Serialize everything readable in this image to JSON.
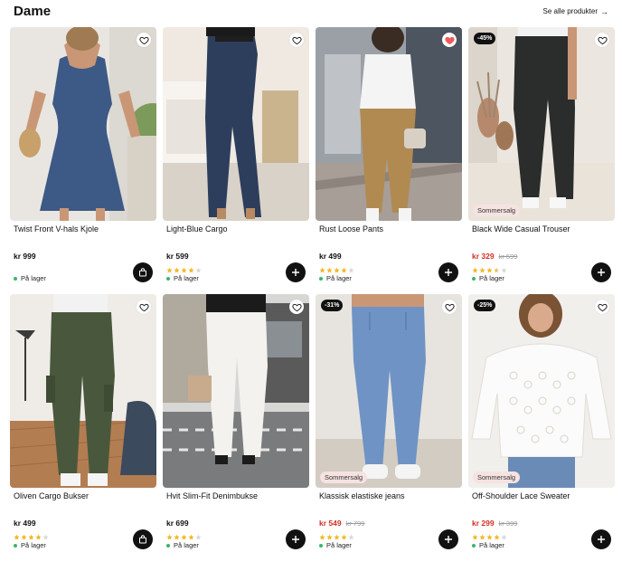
{
  "header": {
    "title": "Dame",
    "see_all": "Se alle produkter",
    "see_all_icon": "arrow-right-icon"
  },
  "colors": {
    "sale_price": "#d02e26",
    "in_stock_dot": "#3bb46b",
    "star_filled": "#f2b822",
    "star_empty": "#d9d9d9",
    "button_bg": "#111111",
    "heart_active": "#f15a5a"
  },
  "products": [
    {
      "name": "Twist Front V-hals Kjole",
      "price": "kr 999",
      "old_price": "",
      "badge": "",
      "sale_tag": "",
      "rating": 0,
      "stock": "På lager",
      "favorited": false,
      "button_icon": "shopping-bag-icon"
    },
    {
      "name": "Light-Blue Cargo",
      "price": "kr 599",
      "old_price": "",
      "badge": "",
      "sale_tag": "",
      "rating": 4,
      "stock": "På lager",
      "favorited": false,
      "button_icon": "plus-icon"
    },
    {
      "name": "Rust Loose Pants",
      "price": "kr 499",
      "old_price": "",
      "badge": "",
      "sale_tag": "",
      "rating": 4,
      "stock": "På lager",
      "favorited": true,
      "button_icon": "plus-icon"
    },
    {
      "name": "Black Wide Casual Trouser",
      "price": "kr 329",
      "old_price": "kr 599",
      "badge": "-45%",
      "sale_tag": "Sommersalg",
      "rating": 3.5,
      "stock": "På lager",
      "favorited": false,
      "button_icon": "plus-icon"
    },
    {
      "name": "Oliven Cargo Bukser",
      "price": "kr 499",
      "old_price": "",
      "badge": "",
      "sale_tag": "",
      "rating": 4,
      "stock": "På lager",
      "favorited": false,
      "button_icon": "shopping-bag-icon"
    },
    {
      "name": "Hvit Slim-Fit Denimbukse",
      "price": "kr 699",
      "old_price": "",
      "badge": "",
      "sale_tag": "",
      "rating": 4,
      "stock": "På lager",
      "favorited": false,
      "button_icon": "plus-icon"
    },
    {
      "name": "Klassisk elastiske jeans",
      "price": "kr 549",
      "old_price": "kr 799",
      "badge": "-31%",
      "sale_tag": "Sommersalg",
      "rating": 4,
      "stock": "På lager",
      "favorited": false,
      "button_icon": "plus-icon"
    },
    {
      "name": "Off-Shoulder Lace Sweater",
      "price": "kr 299",
      "old_price": "kr 399",
      "badge": "-25%",
      "sale_tag": "Sommersalg",
      "rating": 4,
      "stock": "På lager",
      "favorited": false,
      "button_icon": "plus-icon"
    }
  ]
}
